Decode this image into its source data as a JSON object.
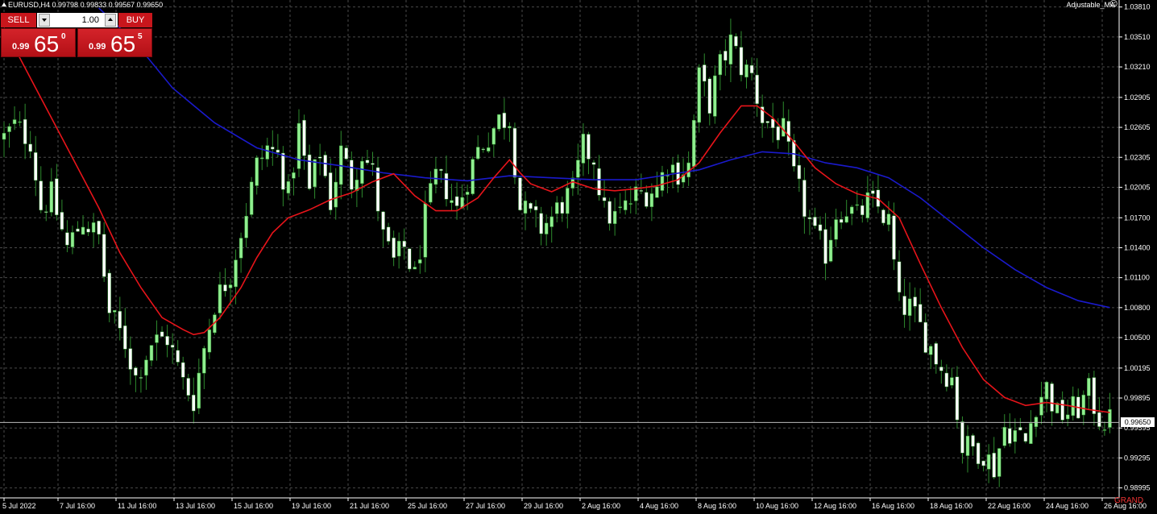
{
  "header": {
    "symbol_tf": "EURUSD,H4",
    "ohlc": "0.99798 0.99833 0.99567 0.99650"
  },
  "indicator": {
    "name": "Adjustable_MA"
  },
  "trade_panel": {
    "sell_label": "SELL",
    "buy_label": "BUY",
    "lot": "1.00",
    "sell_price": {
      "prefix": "0.99",
      "big": "65",
      "sup": "0"
    },
    "buy_price": {
      "prefix": "0.99",
      "big": "65",
      "sup": "5"
    }
  },
  "current_price_label": "0.99650",
  "watermark": "GRAND",
  "colors": {
    "background": "#000000",
    "bull": "#90ee90",
    "bear": "#ffffff",
    "grid": "#4a4a4a",
    "ma_fast": "#e8141a",
    "ma_slow": "#1a1acc",
    "axis": "#ffffff"
  },
  "chart_data": {
    "type": "candlestick",
    "symbol": "EURUSD",
    "timeframe": "H4",
    "ylim": [
      0.98895,
      1.0388
    ],
    "price_ticks": [
      "1.03810",
      "1.03510",
      "1.03210",
      "1.02905",
      "1.02605",
      "1.02305",
      "1.02005",
      "1.01700",
      "1.01400",
      "1.01100",
      "1.00800",
      "1.00500",
      "1.00195",
      "0.99895",
      "0.99595",
      "0.99295",
      "0.98995"
    ],
    "time_ticks": [
      "5 Jul 2022",
      "7 Jul 16:00",
      "11 Jul 16:00",
      "13 Jul 16:00",
      "15 Jul 16:00",
      "19 Jul 16:00",
      "21 Jul 16:00",
      "25 Jul 16:00",
      "27 Jul 16:00",
      "29 Jul 16:00",
      "2 Aug 16:00",
      "4 Aug 16:00",
      "8 Aug 16:00",
      "10 Aug 16:00",
      "12 Aug 16:00",
      "16 Aug 16:00",
      "18 Aug 16:00",
      "22 Aug 16:00",
      "24 Aug 16:00",
      "26 Aug 16:00"
    ],
    "close_anchors": [
      [
        0,
        1.025
      ],
      [
        2,
        1.0262
      ],
      [
        5,
        1.0248
      ],
      [
        7,
        1.018
      ],
      [
        9,
        1.0192
      ],
      [
        12,
        1.014
      ],
      [
        15,
        1.0168
      ],
      [
        18,
        1.015
      ],
      [
        20,
        1.0075
      ],
      [
        23,
        1.0045
      ],
      [
        25,
        1.001
      ],
      [
        28,
        1.0045
      ],
      [
        31,
        1.005
      ],
      [
        34,
        1.0005
      ],
      [
        36,
        0.9988
      ],
      [
        38,
        1.004
      ],
      [
        40,
        1.0085
      ],
      [
        43,
        1.0115
      ],
      [
        46,
        1.0178
      ],
      [
        48,
        1.0222
      ],
      [
        50,
        1.024
      ],
      [
        52,
        1.0232
      ],
      [
        54,
        1.0192
      ],
      [
        56,
        1.0258
      ],
      [
        58,
        1.0196
      ],
      [
        60,
        1.0236
      ],
      [
        62,
        1.0186
      ],
      [
        64,
        1.0236
      ],
      [
        66,
        1.0206
      ],
      [
        68,
        1.0236
      ],
      [
        70,
        1.0214
      ],
      [
        72,
        1.015
      ],
      [
        74,
        1.0125
      ],
      [
        76,
        1.014
      ],
      [
        78,
        1.011
      ],
      [
        80,
        1.017
      ],
      [
        82,
        1.021
      ],
      [
        84,
        1.02
      ],
      [
        86,
        1.0178
      ],
      [
        88,
        1.021
      ],
      [
        90,
        1.0238
      ],
      [
        92,
        1.0252
      ],
      [
        94,
        1.0268
      ],
      [
        96,
        1.027
      ],
      [
        98,
        1.018
      ],
      [
        100,
        1.017
      ],
      [
        102,
        1.016
      ],
      [
        104,
        1.017
      ],
      [
        106,
        1.0185
      ],
      [
        108,
        1.0196
      ],
      [
        110,
        1.024
      ],
      [
        112,
        1.023
      ],
      [
        114,
        1.0175
      ],
      [
        116,
        1.017
      ],
      [
        118,
        1.018
      ],
      [
        120,
        1.0192
      ],
      [
        122,
        1.0196
      ],
      [
        124,
        1.02
      ],
      [
        126,
        1.0225
      ],
      [
        128,
        1.0216
      ],
      [
        130,
        1.0222
      ],
      [
        132,
        1.031
      ],
      [
        134,
        1.0285
      ],
      [
        136,
        1.0322
      ],
      [
        138,
        1.0346
      ],
      [
        140,
        1.0322
      ],
      [
        142,
        1.0312
      ],
      [
        144,
        1.027
      ],
      [
        146,
        1.026
      ],
      [
        148,
        1.0255
      ],
      [
        150,
        1.021
      ],
      [
        152,
        1.018
      ],
      [
        154,
        1.015
      ],
      [
        156,
        1.0135
      ],
      [
        158,
        1.0175
      ],
      [
        160,
        1.018
      ],
      [
        162,
        1.017
      ],
      [
        164,
        1.0185
      ],
      [
        166,
        1.018
      ],
      [
        168,
        1.0165
      ],
      [
        170,
        1.0082
      ],
      [
        172,
        1.008
      ],
      [
        174,
        1.006
      ],
      [
        176,
        1.004
      ],
      [
        178,
        1.002
      ],
      [
        180,
        1.001
      ],
      [
        182,
        0.994
      ],
      [
        184,
        0.994
      ],
      [
        186,
        0.9935
      ],
      [
        188,
        0.992
      ],
      [
        190,
        0.996
      ],
      [
        192,
        0.9955
      ],
      [
        194,
        0.9945
      ],
      [
        196,
        0.9985
      ],
      [
        198,
        1.0
      ],
      [
        200,
        0.9972
      ],
      [
        202,
        0.9975
      ],
      [
        204,
        0.998
      ],
      [
        206,
        0.9995
      ],
      [
        208,
        0.997
      ],
      [
        210,
        0.9965
      ]
    ],
    "series": [
      {
        "name": "Adjustable_MA",
        "style": "line",
        "points": [
          [
            0,
            1.036
          ],
          [
            3,
            1.033
          ],
          [
            6,
            1.03
          ],
          [
            10,
            1.026
          ],
          [
            14,
            1.022
          ],
          [
            18,
            1.018
          ],
          [
            22,
            1.0135
          ],
          [
            26,
            1.01
          ],
          [
            30,
            1.007
          ],
          [
            34,
            1.0058
          ],
          [
            36,
            1.0053
          ],
          [
            38,
            1.0055
          ],
          [
            41,
            1.007
          ],
          [
            45,
            1.01
          ],
          [
            48,
            1.013
          ],
          [
            51,
            1.0155
          ],
          [
            54,
            1.017
          ],
          [
            58,
            1.0178
          ],
          [
            62,
            1.0188
          ],
          [
            66,
            1.0195
          ],
          [
            70,
            1.0206
          ],
          [
            74,
            1.0214
          ],
          [
            78,
            1.0192
          ],
          [
            82,
            1.0177
          ],
          [
            86,
            1.0177
          ],
          [
            90,
            1.019
          ],
          [
            93,
            1.021
          ],
          [
            96,
            1.0228
          ],
          [
            98,
            1.0215
          ],
          [
            100,
            1.0204
          ],
          [
            104,
            1.0196
          ],
          [
            108,
            1.0206
          ],
          [
            112,
            1.0199
          ],
          [
            116,
            1.0197
          ],
          [
            120,
            1.0199
          ],
          [
            124,
            1.0202
          ],
          [
            128,
            1.0208
          ],
          [
            132,
            1.0225
          ],
          [
            136,
            1.0255
          ],
          [
            140,
            1.0282
          ],
          [
            143,
            1.0282
          ],
          [
            146,
            1.027
          ],
          [
            150,
            1.0246
          ],
          [
            154,
            1.022
          ],
          [
            158,
            1.0204
          ],
          [
            162,
            1.0194
          ],
          [
            166,
            1.0189
          ],
          [
            170,
            1.017
          ],
          [
            174,
            1.0124
          ],
          [
            178,
            1.008
          ],
          [
            182,
            1.004
          ],
          [
            186,
            1.0008
          ],
          [
            190,
            0.999
          ],
          [
            194,
            0.9982
          ],
          [
            198,
            0.9985
          ],
          [
            202,
            0.9982
          ],
          [
            206,
            0.9978
          ],
          [
            210,
            0.9975
          ]
        ]
      },
      {
        "name": "",
        "style": "line",
        "points": [
          [
            18,
            1.038
          ],
          [
            25,
            1.0345
          ],
          [
            32,
            1.03
          ],
          [
            40,
            1.0265
          ],
          [
            48,
            1.024
          ],
          [
            56,
            1.0228
          ],
          [
            64,
            1.0222
          ],
          [
            72,
            1.0215
          ],
          [
            80,
            1.021
          ],
          [
            88,
            1.0207
          ],
          [
            96,
            1.0212
          ],
          [
            104,
            1.021
          ],
          [
            112,
            1.0208
          ],
          [
            120,
            1.0208
          ],
          [
            126,
            1.0213
          ],
          [
            132,
            1.0218
          ],
          [
            138,
            1.0228
          ],
          [
            144,
            1.0236
          ],
          [
            150,
            1.0234
          ],
          [
            156,
            1.0225
          ],
          [
            162,
            1.022
          ],
          [
            168,
            1.021
          ],
          [
            174,
            1.019
          ],
          [
            180,
            1.0165
          ],
          [
            186,
            1.014
          ],
          [
            192,
            1.0118
          ],
          [
            198,
            1.01
          ],
          [
            204,
            1.0087
          ],
          [
            210,
            1.008
          ]
        ]
      }
    ],
    "current_price": 0.9965,
    "grid": true
  }
}
